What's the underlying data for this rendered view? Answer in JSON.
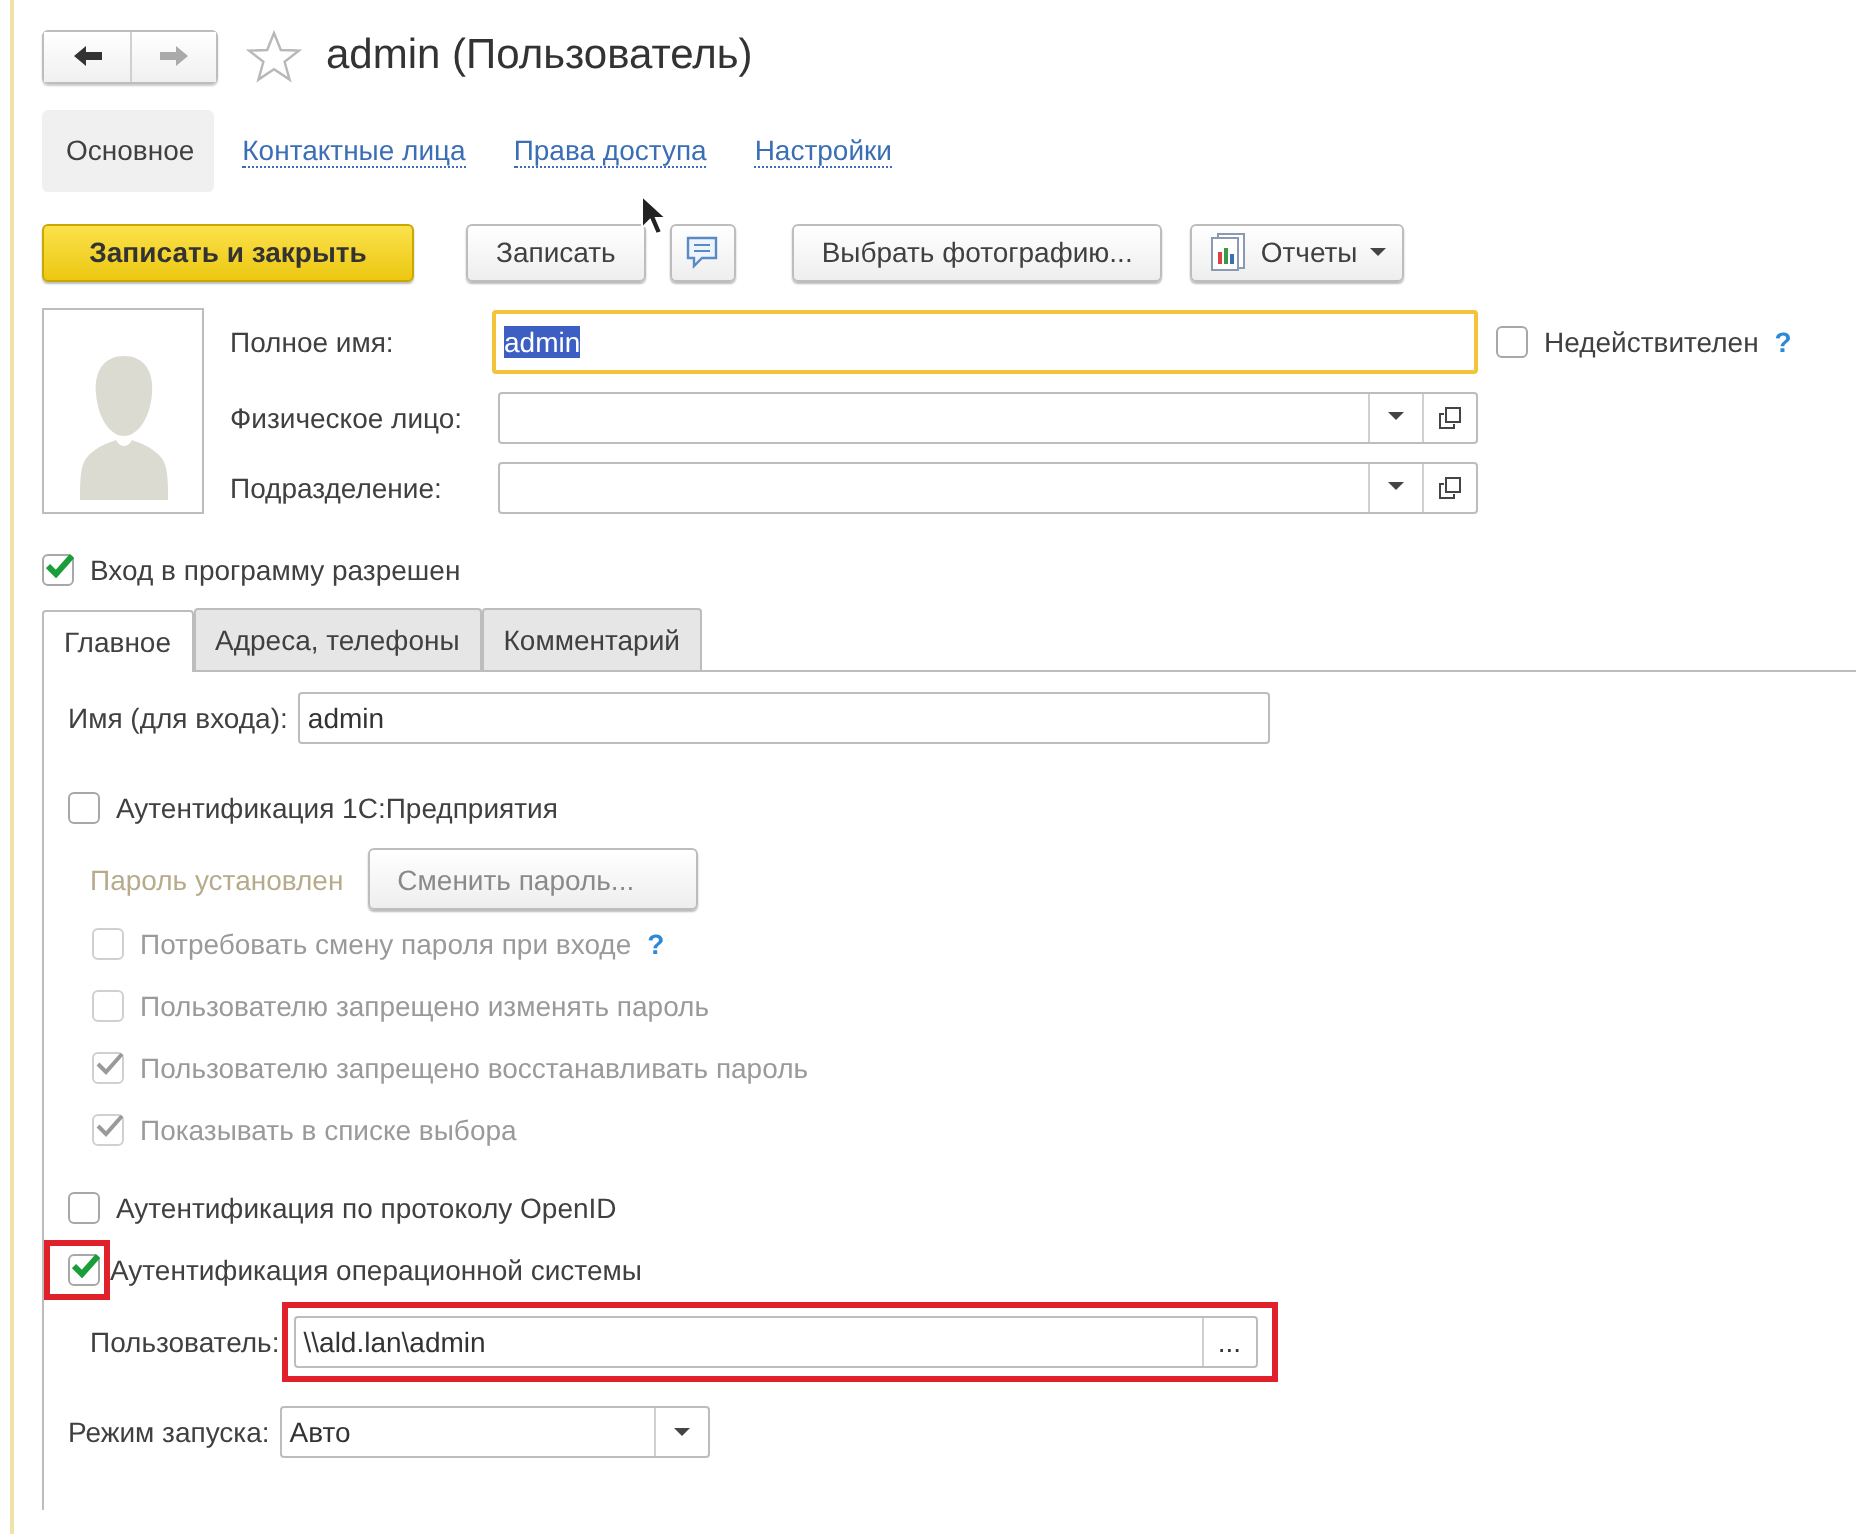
{
  "nav": {
    "back_enabled": true,
    "forward_enabled": false
  },
  "favorite": {
    "starred": false
  },
  "title": "admin (Пользователь)",
  "sections": [
    {
      "label": "Основное",
      "selected": true
    },
    {
      "label": "Контактные лица",
      "selected": false
    },
    {
      "label": "Права доступа",
      "selected": false
    },
    {
      "label": "Настройки",
      "selected": false
    }
  ],
  "toolbar": [
    {
      "kind": "primary",
      "label": "Записать и закрыть"
    },
    {
      "kind": "button",
      "label": "Записать"
    },
    {
      "kind": "comment"
    },
    {
      "kind": "button",
      "label": "Выбрать фотографию..."
    },
    {
      "kind": "menu",
      "label": "Отчеты"
    }
  ],
  "fields": [
    {
      "kind": "text",
      "label": "Полное имя:",
      "value": "admin",
      "focused": true,
      "text_selected": true
    },
    {
      "kind": "choice",
      "label": "Физическое лицо:"
    },
    {
      "kind": "choice",
      "label": "Подразделение:"
    }
  ],
  "invalid": {
    "label": "Недействителен",
    "checked": false,
    "help": "?"
  },
  "login_allowed": {
    "label": "Вход в программу разрешен",
    "checked": true
  },
  "tabs": [
    {
      "label": "Главное",
      "selected": true
    },
    {
      "label": "Адреса, телефоны",
      "selected": false
    },
    {
      "label": "Комментарий",
      "selected": false
    }
  ],
  "login_name": {
    "label": "Имя (для входа):",
    "value": "admin"
  },
  "auth_1c": {
    "label": "Аутентификация 1С:Предприятия",
    "checked": false
  },
  "password": {
    "status": "Пароль установлен",
    "button": "Сменить пароль...",
    "disabled": true
  },
  "password_options": [
    {
      "label": "Потребовать смену пароля при входе",
      "checked": false,
      "disabled": true,
      "help": "?"
    },
    {
      "label": "Пользователю запрещено изменять пароль",
      "checked": false,
      "disabled": true
    },
    {
      "label": "Пользователю запрещено восстанавливать пароль",
      "checked": true,
      "disabled": true
    },
    {
      "label": "Показывать в списке выбора",
      "checked": true,
      "disabled": true
    }
  ],
  "auth_openid": {
    "label": "Аутентификация по протоколу OpenID",
    "checked": false
  },
  "auth_os": {
    "label": "Аутентификация операционной системы",
    "checked": true,
    "highlighted": true
  },
  "os_user": {
    "label": "Пользователь:",
    "value": "\\\\ald.lan\\admin",
    "button": "...",
    "highlighted": true
  },
  "launch_mode": {
    "label": "Режим запуска:",
    "value": "Авто"
  }
}
